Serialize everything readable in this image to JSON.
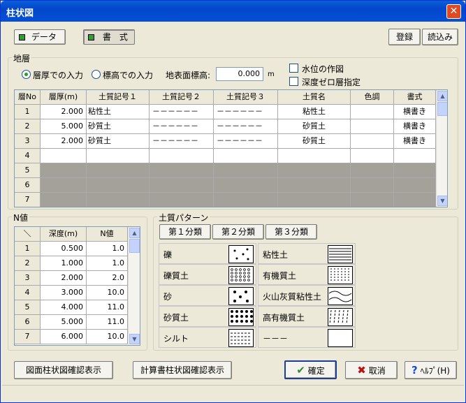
{
  "title": "柱状図",
  "toggle": {
    "data": "データ",
    "format": "書　式"
  },
  "top_buttons": {
    "register": "登録",
    "load": "読込み"
  },
  "strata": {
    "group_label": "地層",
    "radio_thickness": "層厚での入力",
    "radio_elevation": "標高での入力",
    "surface_label": "地表面標高:",
    "surface_value": "0.000",
    "surface_unit": "m",
    "chk_water": "水位の作図",
    "chk_depth": "深度ゼロ層指定",
    "headers": [
      "層No",
      "層厚(m)",
      "土質記号１",
      "土質記号２",
      "土質記号３",
      "土質名",
      "色調",
      "書式"
    ],
    "rows": [
      [
        "1",
        "2.000",
        "粘性土",
        "－－－－－－",
        "－－－－－－",
        "粘性土",
        "",
        "横書き"
      ],
      [
        "2",
        "5.000",
        "砂質土",
        "－－－－－－",
        "－－－－－－",
        "砂質土",
        "",
        "横書き"
      ],
      [
        "3",
        "2.000",
        "砂質土",
        "－－－－－－",
        "－－－－－－",
        "砂質土",
        "",
        "横書き"
      ],
      [
        "4",
        "",
        "",
        "",
        "",
        "",
        "",
        ""
      ],
      [
        "5",
        "",
        "",
        "",
        "",
        "",
        "",
        ""
      ],
      [
        "6",
        "",
        "",
        "",
        "",
        "",
        "",
        ""
      ],
      [
        "7",
        "",
        "",
        "",
        "",
        "",
        "",
        ""
      ]
    ]
  },
  "nvalue": {
    "group_label": "N値",
    "headers": [
      "＼",
      "深度(m)",
      "N値"
    ],
    "rows": [
      [
        "1",
        "0.500",
        "1.0"
      ],
      [
        "2",
        "1.000",
        "1.0"
      ],
      [
        "3",
        "2.000",
        "2.0"
      ],
      [
        "4",
        "3.000",
        "10.0"
      ],
      [
        "5",
        "4.000",
        "11.0"
      ],
      [
        "6",
        "5.000",
        "11.0"
      ],
      [
        "7",
        "6.000",
        "10.0"
      ]
    ]
  },
  "soil": {
    "group_label": "土質パターン",
    "tabs": [
      "第１分類",
      "第２分類",
      "第３分類"
    ],
    "left": [
      "礫",
      "礫質土",
      "砂",
      "砂質土",
      "シルト"
    ],
    "right": [
      "粘性土",
      "有機質土",
      "火山灰質粘性土",
      "高有機質土",
      "－－－"
    ]
  },
  "bottom": {
    "drawing_check": "図面柱状図確認表示",
    "calc_check": "計算書柱状図確認表示",
    "ok": "確定",
    "cancel": "取消",
    "help": "ﾍﾙﾌﾟ(H)"
  },
  "colors": {
    "accent_green": "#2e9e2e",
    "gray_row": "#a4a09a",
    "ok_check": "#2c8f2c",
    "cancel_x": "#c01010",
    "help_q": "#1a4bd0"
  }
}
